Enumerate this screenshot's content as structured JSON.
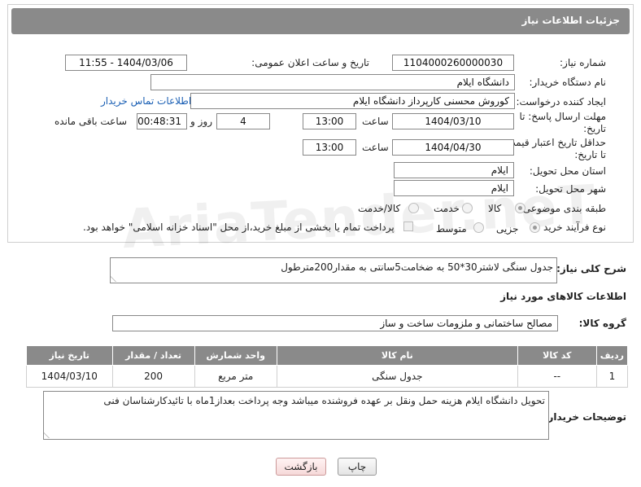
{
  "header": {
    "title": "جزئیات اطلاعات نیاز"
  },
  "need_number": {
    "label": "شماره نیاز:",
    "value": "1104000260000030"
  },
  "announce": {
    "label": "تاریخ و ساعت اعلان عمومی:",
    "value": "1404/03/06 - 11:55"
  },
  "buyer_org": {
    "label": "نام دستگاه خریدار:",
    "value": "دانشگاه ایلام"
  },
  "requester": {
    "label": "ایجاد کننده درخواست:",
    "value": "کوروش محسنی کارپرداز دانشگاه ایلام",
    "contact_link": "اطلاعات تماس خریدار"
  },
  "reply_deadline": {
    "label_line1": "مهلت ارسال پاسخ: تا",
    "label_line2": "تاریخ:",
    "date": "1404/03/10",
    "time_label": "ساعت",
    "time": "13:00",
    "days": "4",
    "days_label": "روز و",
    "remaining": "00:48:31",
    "remaining_label": "ساعت باقی مانده"
  },
  "price_validity": {
    "label_line1": "حداقل تاریخ اعتبار قیمت:",
    "label_line2": "تا تاریخ:",
    "date": "1404/04/30",
    "time_label": "ساعت",
    "time": "13:00"
  },
  "province": {
    "label": "استان محل تحویل:",
    "value": "ایلام"
  },
  "city": {
    "label": "شهر محل تحویل:",
    "value": "ایلام"
  },
  "category": {
    "label": "طبقه بندی موضوعی:",
    "options": [
      "کالا",
      "خدمت",
      "کالا/خدمت"
    ],
    "selected": "کالا"
  },
  "purchase_type": {
    "label": "نوع فرآیند خرید :",
    "options": [
      "جزیی",
      "متوسط"
    ],
    "selected": "جزیی",
    "note": "پرداخت تمام یا بخشی از مبلغ خرید،از محل \"اسناد خزانه اسلامی\" خواهد بود."
  },
  "description": {
    "label": "شرح کلی نیاز:",
    "value": "جدول سنگی لاشتر30*50 به ضخامت5سانتی به مقدار200مترطول"
  },
  "goods_info": {
    "title": "اطلاعات کالاهای مورد نیاز"
  },
  "goods_group": {
    "label": "گروه کالا:",
    "value": "مصالح ساختمانی و ملزومات ساخت و ساز"
  },
  "table": {
    "headers": [
      "ردیف",
      "کد کالا",
      "نام کالا",
      "واحد شمارش",
      "تعداد / مقدار",
      "تاریخ نیاز"
    ],
    "rows": [
      [
        "1",
        "--",
        "جدول سنگی",
        "متر مربع",
        "200",
        "1404/03/10"
      ]
    ]
  },
  "buyer_notes": {
    "label": "توضیحات خریدار:",
    "value": "تحویل دانشگاه ایلام هزینه حمل ونقل بر عهده فروشنده میباشد وجه پرداخت بعداز1ماه با تائیدکارشناسان فنی"
  },
  "buttons": {
    "print": "چاپ",
    "back": "بازگشت"
  },
  "watermark": "AriaTender.neT"
}
